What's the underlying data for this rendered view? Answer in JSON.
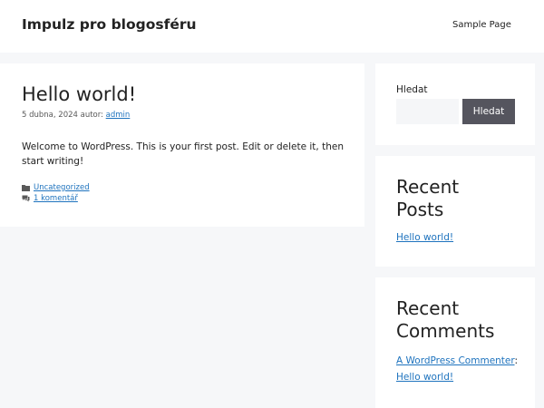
{
  "header": {
    "site_title": "Impulz pro blogosféru",
    "nav": {
      "sample_page": "Sample Page"
    }
  },
  "post": {
    "title": "Hello world!",
    "date": "5 dubna, 2024",
    "author_prefix": "autor:",
    "author": "admin",
    "content": "Welcome to WordPress. This is your first post. Edit or delete it, then start writing!",
    "category": "Uncategorized",
    "comments_link": "1 komentář",
    "category_icon": "folder-icon",
    "comments_icon": "comment-icon"
  },
  "sidebar": {
    "search": {
      "label": "Hledat",
      "placeholder": "",
      "button": "Hledat"
    },
    "recent_posts": {
      "title_line1": "Recent",
      "title_line2": "Posts",
      "items": [
        "Hello world!"
      ]
    },
    "recent_comments": {
      "title_line1": "Recent",
      "title_line2": "Comments",
      "items": [
        {
          "author": "A WordPress Commenter",
          "separator": ":",
          "post": "Hello world!"
        }
      ]
    }
  },
  "colors": {
    "background": "#f6f7f9",
    "card": "#ffffff",
    "link": "#1e73be",
    "button": "#55555e",
    "text": "#222222"
  }
}
